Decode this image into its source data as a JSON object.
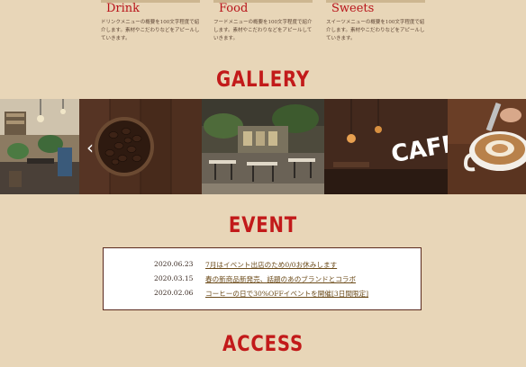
{
  "menu": {
    "items": [
      {
        "title": "Drink",
        "desc": "ドリンクメニューの概要を100文字程度で紹介します。素材やこだわりなどをアピールしていきます。"
      },
      {
        "title": "Food",
        "desc": "フードメニューの概要を100文字程度で紹介します。素材やこだわりなどをアピールしていきます。"
      },
      {
        "title": "Sweets",
        "desc": "スイーツメニューの概要を100文字程度で紹介します。素材やこだわりなどをアピールしていきます。"
      }
    ]
  },
  "gallery": {
    "title": "GALLERY",
    "prev_arrow": "‹",
    "photos": [
      "cafe-interior-plants",
      "coffee-beans-bowl",
      "cafe-interior-seating",
      "cafe-neon-sign",
      "latte-art-cup"
    ],
    "cafe_sign": "CAFE"
  },
  "event": {
    "title": "EVENT",
    "items": [
      {
        "date": "2020.06.23",
        "text": "7月はイベント出店のため0/0お休みします"
      },
      {
        "date": "2020.03.15",
        "text": "春の新商品新発売、話題のあのブランドとコラボ"
      },
      {
        "date": "2020.02.06",
        "text": "コーヒーの日で30%OFFイベントを開催[3日間限定]"
      }
    ]
  },
  "access": {
    "title": "ACCESS"
  },
  "colors": {
    "background": "#e8d6b8",
    "heading": "#c21a1a",
    "box_border": "#5a2a1e"
  }
}
